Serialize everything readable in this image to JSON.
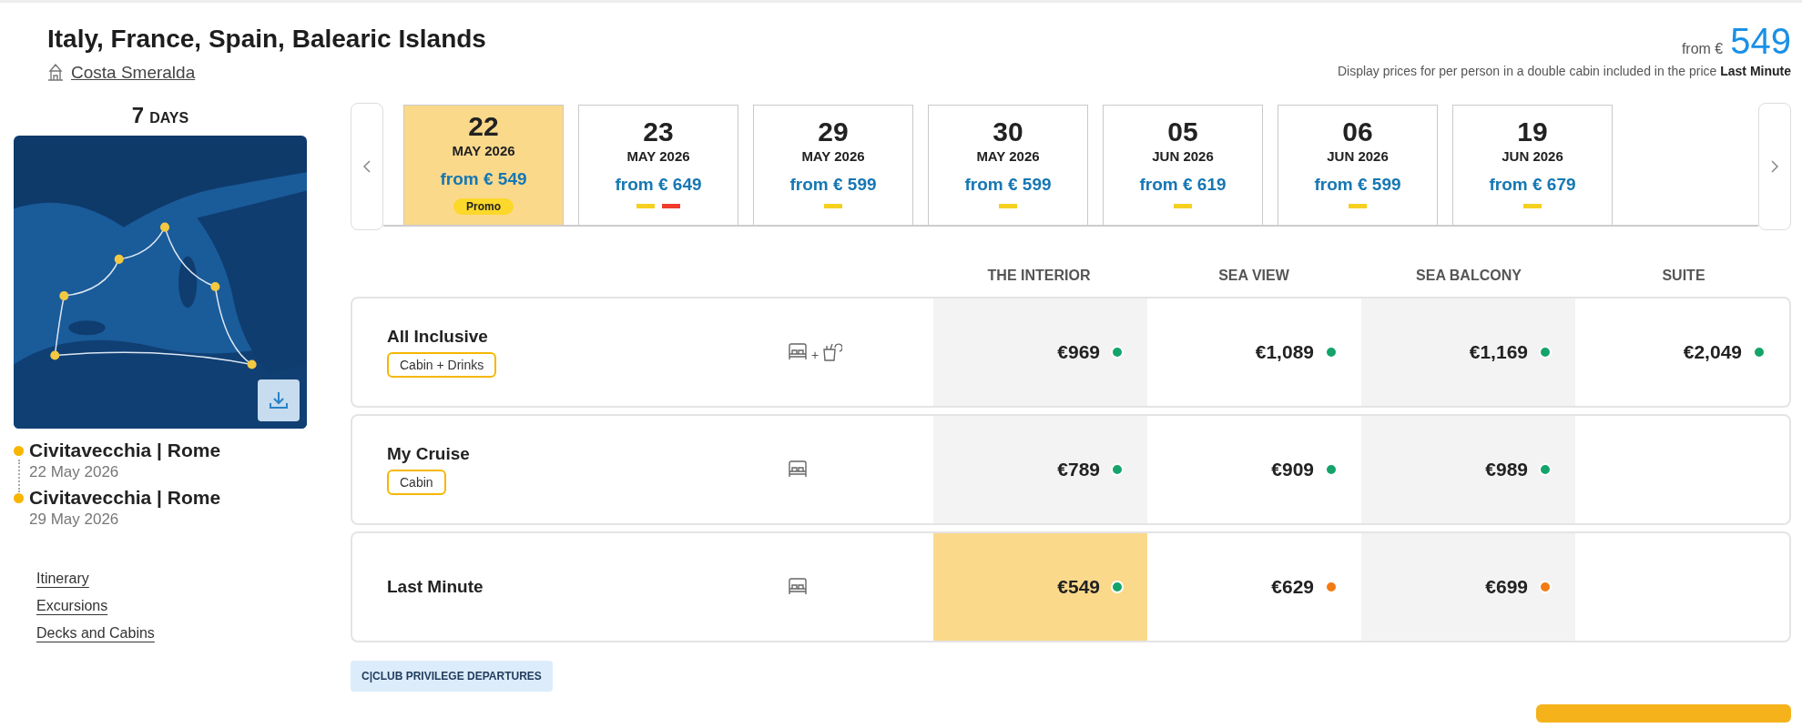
{
  "header": {
    "title": "Italy, France, Spain, Balearic Islands",
    "ship": "Costa Smeralda",
    "price_prefix": "from €",
    "price": "549",
    "note": "Display prices for per person in a double cabin included in the price ",
    "note_bold": "Last Minute"
  },
  "sidebar": {
    "days": "7",
    "days_label": "DAYS",
    "map": {
      "kind": "picture"
    },
    "stops": [
      {
        "port": "Civitavecchia | Rome",
        "date": "22 May 2026"
      },
      {
        "port": "Civitavecchia | Rome",
        "date": "29 May 2026"
      }
    ],
    "links": [
      "Itinerary",
      "Excursions",
      "Decks and Cabins"
    ]
  },
  "dates": [
    {
      "day": "22",
      "month": "MAY 2026",
      "price": "from € 549",
      "selected": true,
      "badge": "Promo"
    },
    {
      "day": "23",
      "month": "MAY 2026",
      "price": "from € 649",
      "selected": false,
      "marks": [
        {
          "color": "#f5d020"
        },
        {
          "color": "#ee3b2b"
        }
      ]
    },
    {
      "day": "29",
      "month": "MAY 2026",
      "price": "from € 599",
      "selected": false,
      "marks": [
        {
          "color": "#f5d020"
        }
      ]
    },
    {
      "day": "30",
      "month": "MAY 2026",
      "price": "from € 599",
      "selected": false,
      "marks": [
        {
          "color": "#f5d020"
        }
      ]
    },
    {
      "day": "05",
      "month": "JUN 2026",
      "price": "from € 619",
      "selected": false,
      "marks": [
        {
          "color": "#f5d020"
        }
      ]
    },
    {
      "day": "06",
      "month": "JUN 2026",
      "price": "from € 599",
      "selected": false,
      "marks": [
        {
          "color": "#f5d020"
        }
      ]
    },
    {
      "day": "19",
      "month": "JUN 2026",
      "price": "from € 679",
      "selected": false,
      "marks": [
        {
          "color": "#f5d020"
        }
      ]
    }
  ],
  "table": {
    "columns": [
      "THE INTERIOR",
      "SEA VIEW",
      "SEA BALCONY",
      "SUITE"
    ],
    "rows": [
      {
        "name": "All Inclusive",
        "tag": "Cabin + Drinks",
        "kind": "cabin_drinks",
        "plus": "+",
        "prices": [
          {
            "price": "€969",
            "color": "#14a46b",
            "selected": false
          },
          {
            "price": "€1,089",
            "color": "#14a46b",
            "selected": false
          },
          {
            "price": "€1,169",
            "color": "#14a46b",
            "selected": false
          },
          {
            "price": "€2,049",
            "color": "#14a46b",
            "selected": false
          }
        ]
      },
      {
        "name": "My Cruise",
        "tag": "Cabin",
        "kind": "cabin",
        "prices": [
          {
            "price": "€789",
            "color": "#14a46b",
            "selected": false
          },
          {
            "price": "€909",
            "color": "#14a46b",
            "selected": false
          },
          {
            "price": "€989",
            "color": "#14a46b",
            "selected": false
          }
        ]
      },
      {
        "name": "Last Minute",
        "kind": "cabin",
        "prices": [
          {
            "price": "€549",
            "color": "#14a46b",
            "selected": true
          },
          {
            "price": "€629",
            "color": "#f27b12",
            "selected": false
          },
          {
            "price": "€699",
            "color": "#f27b12",
            "selected": false
          }
        ]
      }
    ]
  },
  "club_badge": "C|CLUB PRIVILEGE DEPARTURES"
}
